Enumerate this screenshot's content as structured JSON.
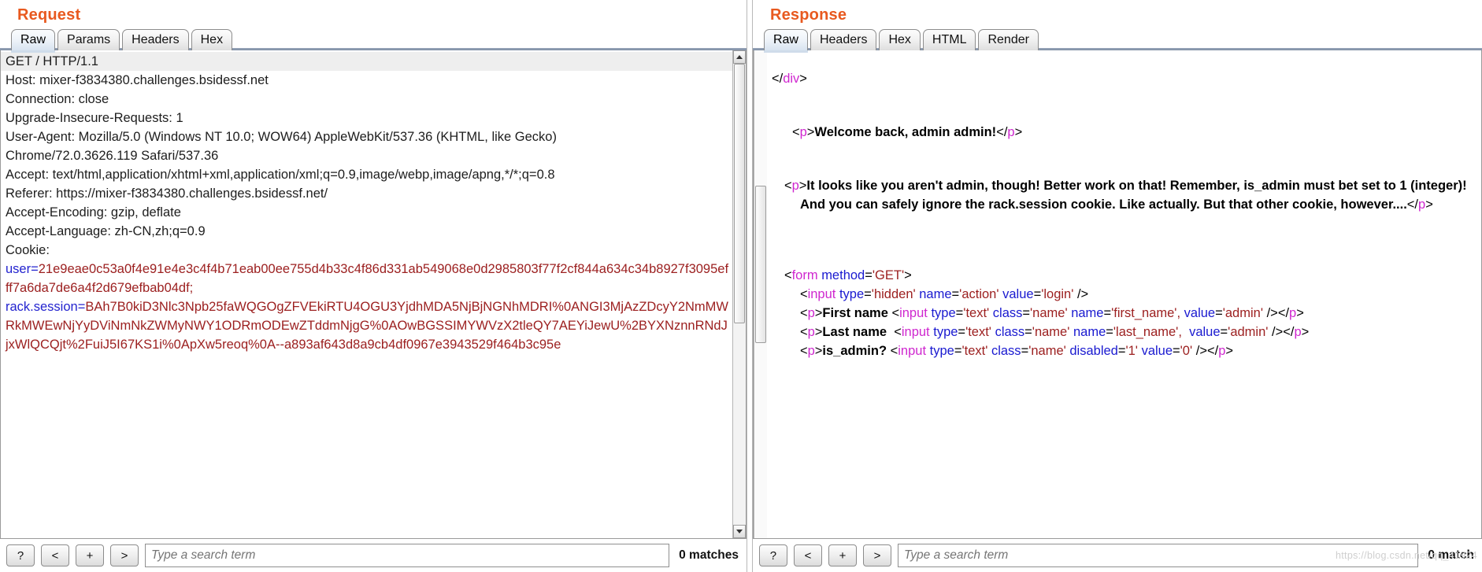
{
  "request": {
    "title": "Request",
    "tabs": [
      {
        "label": "Raw",
        "active": true
      },
      {
        "label": "Params",
        "active": false
      },
      {
        "label": "Headers",
        "active": false
      },
      {
        "label": "Hex",
        "active": false
      }
    ],
    "lines": {
      "request_line": "GET / HTTP/1.1",
      "host": "Host: mixer-f3834380.challenges.bsidessf.net",
      "connection": "Connection: close",
      "upgrade": "Upgrade-Insecure-Requests: 1",
      "user_agent_1": "User-Agent: Mozilla/5.0 (Windows NT 10.0; WOW64) AppleWebKit/537.36 (KHTML, like Gecko)",
      "user_agent_2": "Chrome/72.0.3626.119 Safari/537.36",
      "accept": "Accept: text/html,application/xhtml+xml,application/xml;q=0.9,image/webp,image/apng,*/*;q=0.8",
      "referer": "Referer: https://mixer-f3834380.challenges.bsidessf.net/",
      "accept_encoding": "Accept-Encoding: gzip, deflate",
      "accept_language": "Accept-Language: zh-CN,zh;q=0.9",
      "cookie_label": "Cookie:"
    },
    "cookies": [
      {
        "key": "user",
        "eq": "=",
        "value_lines": [
          "21e9eae0c53a0f4e91e4e3c4f4b71eab00ee755d4b33c4f86d331ab549068e0d2985803f77f2cf8",
          "44a634c34b8927f3095efff7a6da7de6a4f2d679efbab04df;"
        ]
      },
      {
        "key": "rack.session",
        "eq": "=",
        "value_lines": [
          "BAh7B0kiD3Nlc3Npb25faWQGOgZFVEkiRTU4OGU3YjdhMDA5NjBjNGNhMDRI%0AN",
          "GI3MjAzZDcyY2NmMWRkMWEwNjYyDViNmNkZWMyNWY1ODRmODEwZTddmNjgG%0AOwBGS",
          "SIMYWVzX2tleQY7AEYiJewU%2BYXNznnRNdJjxWlQCQjt%2FuiJ5I67KS1i%0ApXw5reoq%0A--a89",
          "3af643d8a9cb4df0967e3943529f464b3c95e"
        ]
      }
    ],
    "search": {
      "help_label": "?",
      "prev_label": "<",
      "add_label": "+",
      "next_label": ">",
      "placeholder": "Type a search term",
      "value": "",
      "matches": "0 matches"
    }
  },
  "response": {
    "title": "Response",
    "tabs": [
      {
        "label": "Raw",
        "active": true
      },
      {
        "label": "Headers",
        "active": false
      },
      {
        "label": "Hex",
        "active": false
      },
      {
        "label": "HTML",
        "active": false
      },
      {
        "label": "Render",
        "active": false
      }
    ],
    "body": {
      "close_div": {
        "open": "</",
        "tag": "div",
        "close": ">"
      },
      "welcome": {
        "open_lt": "<",
        "open_tag": "p",
        "open_gt": ">",
        "text": "Welcome back, admin admin!",
        "close_lt": "</",
        "close_tag": "p",
        "close_gt": ">"
      },
      "notice": {
        "open_lt": "<",
        "open_tag": "p",
        "open_gt": ">",
        "text": "It looks like you aren't admin, though! Better work on that! Remember, is_admin must bet set to 1 (integer)! And you can safely ignore the rack.session cookie. Like actually. But that other cookie, however....",
        "close_lt": "</",
        "close_tag": "p",
        "close_gt": ">"
      },
      "form_open": {
        "lt": "<",
        "tag": "form",
        "attr": "method",
        "eq": "=",
        "value": "'GET'",
        "gt": ">"
      },
      "input_hidden": {
        "lt": "<",
        "tag": "input",
        "a1": "type",
        "v1": "'hidden'",
        "a2": "name",
        "v2": "'action'",
        "a3": "value",
        "v3": "'login'",
        "gt": "/>"
      },
      "first_name": {
        "p_lt": "<",
        "p_tag": "p",
        "p_gt": ">",
        "label": "First name ",
        "lt": "<",
        "tag": "input",
        "a1": "type",
        "v1": "'text'",
        "a2": "class",
        "v2": "'name'",
        "a3": "name",
        "v3": "'first_name',",
        "a4": "value",
        "v4": "'admin'",
        "gt": "/>",
        "pc_lt": "</",
        "pc_tag": "p",
        "pc_gt": ">"
      },
      "last_name": {
        "p_lt": "<",
        "p_tag": "p",
        "p_gt": ">",
        "label": "Last name  ",
        "lt": "<",
        "tag": "input",
        "a1": "type",
        "v1": "'text'",
        "a2": "class",
        "v2": "'name'",
        "a3": "name",
        "v3": "'last_name',",
        "a4": "value",
        "v4": "'admin'",
        "gt": "/>",
        "pc_lt": "</",
        "pc_tag": "p",
        "pc_gt": ">"
      },
      "is_admin": {
        "p_lt": "<",
        "p_tag": "p",
        "p_gt": ">",
        "label": "is_admin? ",
        "lt": "<",
        "tag": "input",
        "a1": "type",
        "v1": "'text'",
        "a2": "class",
        "v2": "'name'",
        "a3": "disabled",
        "v3": "'1'",
        "a4": "value",
        "v4": "'0'",
        "gt": "/>",
        "pc_lt": "</",
        "pc_tag": "p",
        "pc_gt": ">"
      }
    },
    "search": {
      "help_label": "?",
      "prev_label": "<",
      "add_label": "+",
      "next_label": ">",
      "placeholder": "Type a search term",
      "value": "",
      "matches": "0 match"
    }
  },
  "watermark": "https://blog.csdn.net/qq_41924"
}
